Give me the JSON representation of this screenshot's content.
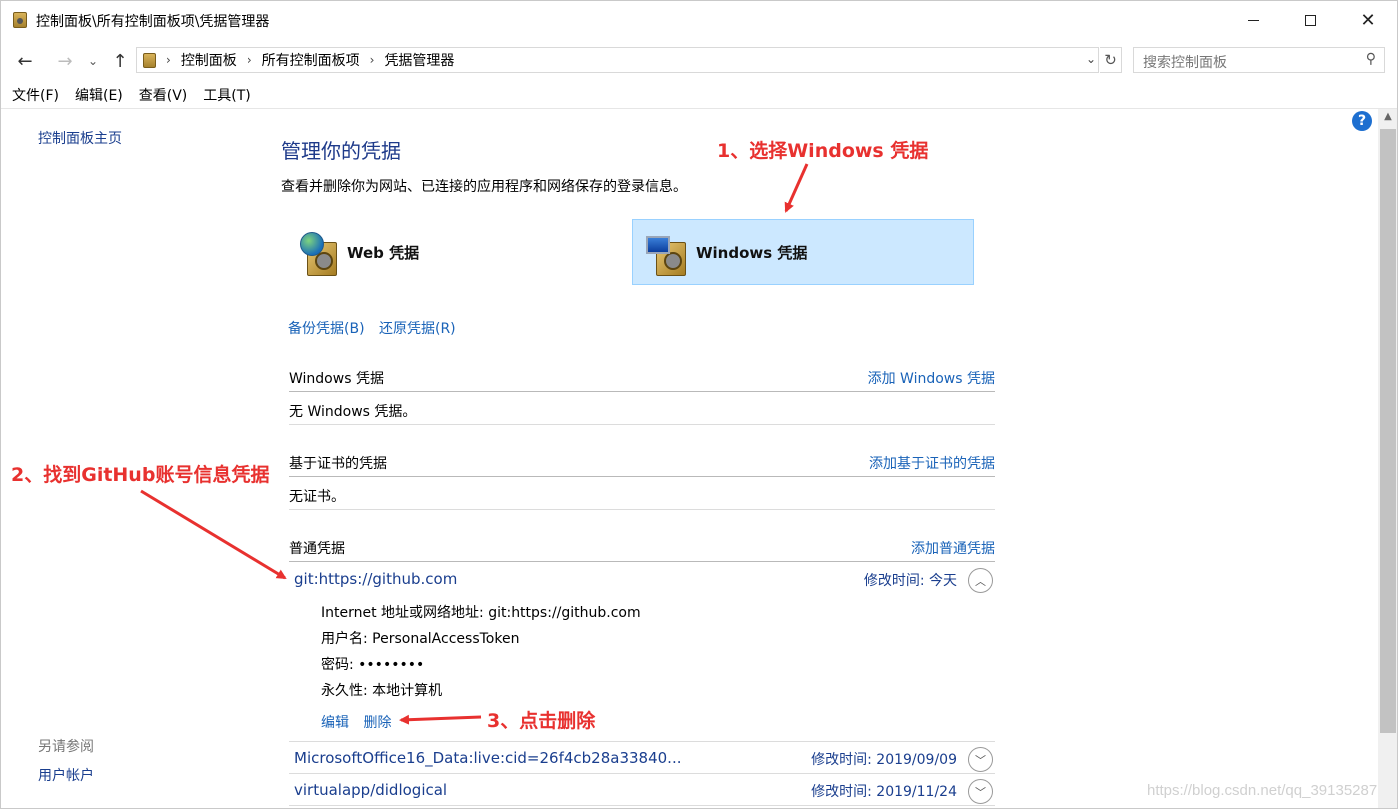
{
  "window": {
    "title": "控制面板\\所有控制面板项\\凭据管理器"
  },
  "address": {
    "crumbs": [
      "控制面板",
      "所有控制面板项",
      "凭据管理器"
    ],
    "search_placeholder": "搜索控制面板"
  },
  "menu": [
    "文件(F)",
    "编辑(E)",
    "查看(V)",
    "工具(T)"
  ],
  "left": {
    "home": "控制面板主页",
    "see_also": "另请参阅",
    "user_accounts": "用户帐户"
  },
  "main": {
    "title": "管理你的凭据",
    "description": "查看并删除你为网站、已连接的应用程序和网络保存的登录信息。",
    "tiles": {
      "web": "Web 凭据",
      "windows": "Windows 凭据"
    },
    "backup": "备份凭据(B)",
    "restore": "还原凭据(R)",
    "sections": {
      "windows": {
        "title": "Windows 凭据",
        "add": "添加 Windows 凭据",
        "empty": "无 Windows 凭据。"
      },
      "cert": {
        "title": "基于证书的凭据",
        "add": "添加基于证书的凭据",
        "empty": "无证书。"
      },
      "generic": {
        "title": "普通凭据",
        "add": "添加普通凭据"
      }
    },
    "credentials": [
      {
        "name": "git:https://github.com",
        "modified": "修改时间:  今天"
      },
      {
        "name": "MicrosoftOffice16_Data:live:cid=26f4cb28a33840...",
        "modified": "修改时间:  2019/09/09"
      },
      {
        "name": "virtualapp/didlogical",
        "modified": "修改时间:  2019/11/24"
      }
    ],
    "detail": {
      "address": "Internet 地址或网络地址:  git:https://github.com",
      "user": "用户名:  PersonalAccessToken",
      "password": "密码:  ••••••••",
      "persistence": "永久性:  本地计算机",
      "edit": "编辑",
      "delete": "删除"
    }
  },
  "annotations": {
    "step1": "1、选择Windows 凭据",
    "step2": "2、找到GitHub账号信息凭据",
    "step3": "3、点击删除"
  },
  "watermark": "https://blog.csdn.net/qq_39135287",
  "colors": {
    "annotation": "#e8312f",
    "link": "#1a63b8",
    "selected_tile": "#cce8ff"
  }
}
